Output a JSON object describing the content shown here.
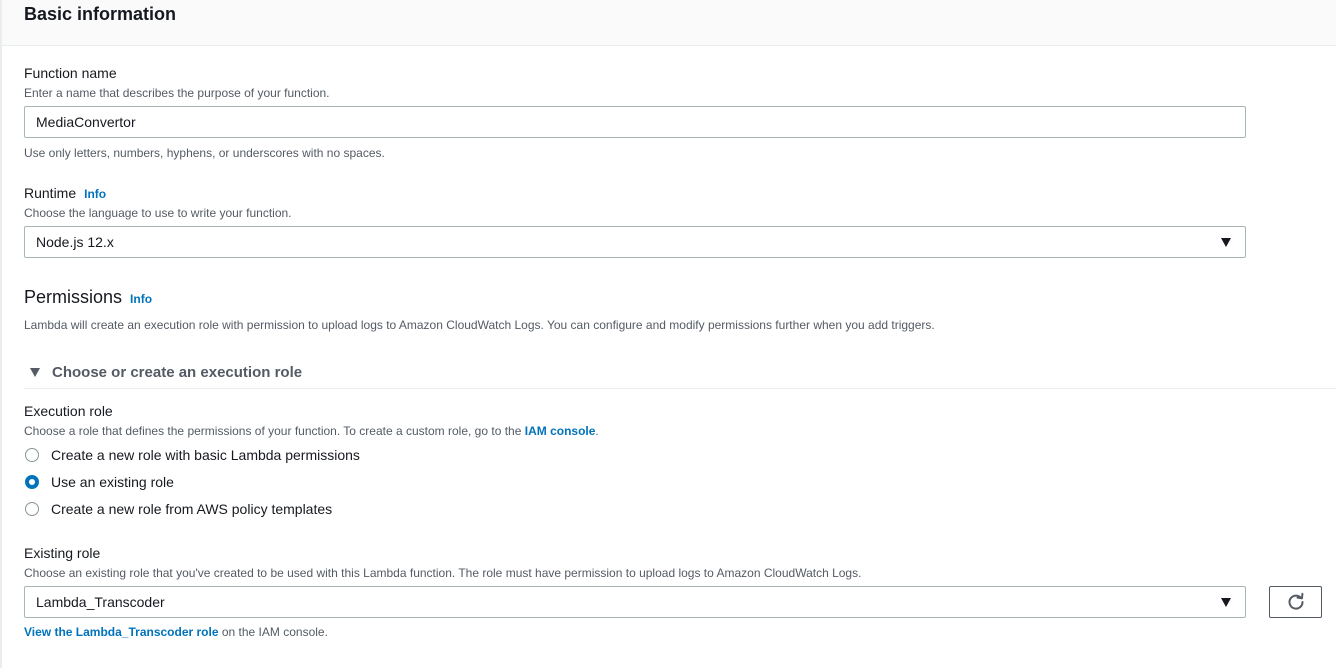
{
  "header": {
    "title": "Basic information"
  },
  "function_name": {
    "label": "Function name",
    "description": "Enter a name that describes the purpose of your function.",
    "value": "MediaConvertor",
    "hint": "Use only letters, numbers, hyphens, or underscores with no spaces."
  },
  "runtime": {
    "label": "Runtime",
    "info": "Info",
    "description": "Choose the language to use to write your function.",
    "selected": "Node.js 12.x"
  },
  "permissions": {
    "title": "Permissions",
    "info": "Info",
    "description": "Lambda will create an execution role with permission to upload logs to Amazon CloudWatch Logs. You can configure and modify permissions further when you add triggers.",
    "expander_label": "Choose or create an execution role"
  },
  "execution_role": {
    "label": "Execution role",
    "description_prefix": "Choose a role that defines the permissions of your function. To create a custom role, go to the",
    "description_link": "IAM console",
    "description_suffix": ".",
    "options": [
      {
        "label": "Create a new role with basic Lambda permissions",
        "checked": false
      },
      {
        "label": "Use an existing role",
        "checked": true
      },
      {
        "label": "Create a new role from AWS policy templates",
        "checked": false
      }
    ]
  },
  "existing_role": {
    "label": "Existing role",
    "description": "Choose an existing role that you've created to be used with this Lambda function. The role must have permission to upload logs to Amazon CloudWatch Logs.",
    "selected": "Lambda_Transcoder",
    "view_link": "View the Lambda_Transcoder role",
    "view_suffix": " on the IAM console."
  },
  "icons": {
    "dropdown": "caret-down-icon",
    "expander": "caret-down-icon",
    "refresh": "refresh-icon"
  },
  "colors": {
    "accent": "#0073bb",
    "text": "#16191f",
    "secondary_text": "#545b64",
    "border": "#aab7b8"
  }
}
